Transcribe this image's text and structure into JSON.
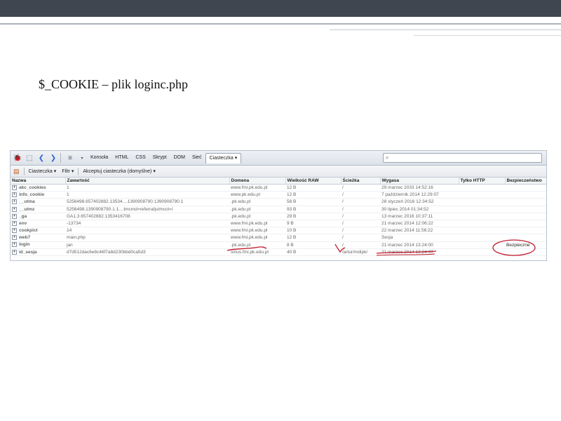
{
  "slide": {
    "title": "$_COOKIE – plik loginc.php"
  },
  "toolbar": {
    "tabs": [
      "Konsola",
      "HTML",
      "CSS",
      "Skrypt",
      "DOM",
      "Sieć"
    ],
    "active_tab": "Ciasteczka ▾",
    "search_placeholder": "",
    "search_icon": "magnifier-icon"
  },
  "subbar": {
    "cookies_menu": "Ciasteczka ▾",
    "filter_menu": "Filtr ▾",
    "accept_menu": "Akceptuj ciasteczka (domyślne) ▾"
  },
  "table": {
    "columns": [
      "Nazwa",
      "Zawartość",
      "Domena",
      "Wielkość RAW",
      "Ścieżka",
      "Wygasa",
      "Tylko HTTP",
      "Bezpieczeństwo"
    ],
    "rows": [
      {
        "name": "akc_cookies",
        "value": "1",
        "domain": "www.fmi.pk.edu.pl",
        "size": "12 B",
        "path": "/",
        "expires": "29 marzec 2033 14:52:16",
        "http": "",
        "secure": ""
      },
      {
        "name": "info_cookie",
        "value": "1",
        "domain": "www.pk.edu.pl",
        "size": "12 B",
        "path": "/",
        "expires": "7 październik 2014 12:29:07",
        "http": "",
        "secure": ""
      },
      {
        "name": "__utma",
        "value": "5256498.657402882.13534....1390908790.1390908790.1",
        "domain": ".pk.edu.pl",
        "size": "58 B",
        "path": "/",
        "expires": "28 styczeń 2016 12:34:52",
        "http": "",
        "secure": ""
      },
      {
        "name": "__utmz",
        "value": "5256498.1390908790.1.1....tmcmd=referral|utmcct=/",
        "domain": ".pk.edu.pl",
        "size": "93 B",
        "path": "/",
        "expires": "30 lipiec 2014 01:34:52",
        "http": "",
        "secure": ""
      },
      {
        "name": "_ga",
        "value": "GA1.3.657402882.1353416708",
        "domain": ".pk.edu.pl",
        "size": "29 B",
        "path": "/",
        "expires": "13 marzec 2016 10:37:11",
        "http": "",
        "secure": ""
      },
      {
        "name": "env",
        "value": "-13734",
        "domain": "www.fmi.pk.edu.pl",
        "size": "9 B",
        "path": "/",
        "expires": "21 marzec 2014 12:06:22",
        "http": "",
        "secure": ""
      },
      {
        "name": "cookpict",
        "value": "14",
        "domain": "www.fmi.pk.edu.pl",
        "size": "10 B",
        "path": "/",
        "expires": "22 marzec 2014 11:56:22",
        "http": "",
        "secure": ""
      },
      {
        "name": "web7",
        "value": "main.php",
        "domain": "www.fmi.pk.edu.pl",
        "size": "12 B",
        "path": "/",
        "expires": "Sesja",
        "http": "",
        "secure": ""
      },
      {
        "name": "login",
        "value": "jan",
        "domain": ".pk.edu.pl",
        "size": "8 B",
        "path": "/",
        "expires": "21 marzec 2014 13:24:00",
        "http": "",
        "secure": "Bezpieczne"
      },
      {
        "name": "id_sesja",
        "value": "d7d512dac6e8c46f7a8d230bbd0ca5d3",
        "domain": "sirius.fmi.pk.edu.pl",
        "size": "40 B",
        "path": "/artur/mdipk/",
        "expires": "21 marzec 2014 13:24:00",
        "http": "",
        "secure": ""
      }
    ]
  },
  "annotations": {
    "color": "#c0182a"
  }
}
